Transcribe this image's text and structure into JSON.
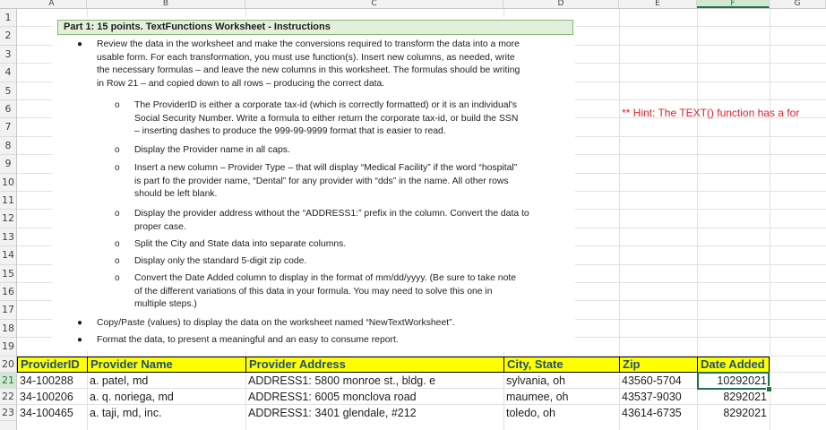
{
  "sheet": {
    "column_headers": [
      "A",
      "B",
      "C",
      "D",
      "E",
      "F",
      "G"
    ],
    "selected_column": "F",
    "row_numbers": [
      "1",
      "2",
      "3",
      "4",
      "5",
      "6",
      "7",
      "8",
      "9",
      "10",
      "11",
      "12",
      "13",
      "14",
      "15",
      "16",
      "17",
      "18",
      "19",
      "20",
      "21",
      "22",
      "23"
    ],
    "selected_row": "21"
  },
  "instructions": {
    "title": "Part 1:  15 points. TextFunctions Worksheet  - Instructions",
    "bullet_1": [
      "Review the data in the worksheet and make the conversions required to transform the data into a more",
      "usable form.  For each transformation, you must use function(s).  Insert new columns, as needed, write",
      "the necessary formulas – and leave the new columns in this worksheet.  The formulas should be writing",
      "in Row 21 – and copied down to all rows – producing the correct data."
    ],
    "sub_1": [
      "The ProviderID is either a corporate tax-id (which is correctly formatted) or it is an individual's",
      "Social Security Number.   Write a formula to either return the corporate tax-id, or build the SSN",
      "– inserting dashes to produce the 999-99-9999 format that is easier to read."
    ],
    "sub_2": [
      "Display the Provider name in all caps."
    ],
    "sub_3": [
      "Insert a new column – Provider Type – that will display “Medical Facility” if the word “hospital”",
      "is part fo the provider name, “Dental” for any provider with “dds” in the name.  All other rows",
      "should be left blank."
    ],
    "sub_4": [
      "Display the provider address without the “ADDRESS1:” prefix in the column.  Convert the data to",
      "proper case."
    ],
    "sub_5": [
      "Split the City and State data into separate columns."
    ],
    "sub_6": [
      "Display only the standard 5-digit zip code."
    ],
    "sub_7": [
      "Convert the Date Added column to display in the format of mm/dd/yyyy.  (Be sure to take note",
      "of the different variations of this data in your formula.  You may need to solve this one in",
      "multiple steps.)"
    ],
    "bullet_2": [
      "Copy/Paste (values) to display the data on the worksheet named “NewTextWorksheet”."
    ],
    "bullet_3": [
      "Format the data, to present a meaningful and an easy to consume report."
    ],
    "bullet_symbol": "●",
    "sub_symbol": "o"
  },
  "hint_text": "** Hint: The TEXT() function has a for",
  "table": {
    "headers": [
      "ProviderID",
      "Provider Name",
      "Provider Address",
      "City, State",
      "Zip",
      "Date Added"
    ],
    "rows": [
      [
        "34-100288",
        "a. patel, md",
        "ADDRESS1:  5800 monroe st., bldg. e",
        "sylvania, oh",
        "43560-5704",
        "10292021"
      ],
      [
        "34-100206",
        "a. q. noriega, md",
        "ADDRESS1:  6005 monclova road",
        "maumee, oh",
        "43537-9030",
        "8292021"
      ],
      [
        "34-100465",
        "a. taji, md, inc.",
        "ADDRESS1:  3401 glendale, #212",
        "toledo, oh",
        "43614-6735",
        "8292021"
      ]
    ]
  },
  "colors": {
    "header_fill": "#ffff00",
    "header_text": "#1f4e79",
    "hint_text": "#e0202a",
    "selection": "#217346",
    "title_fill": "#e2efda"
  }
}
